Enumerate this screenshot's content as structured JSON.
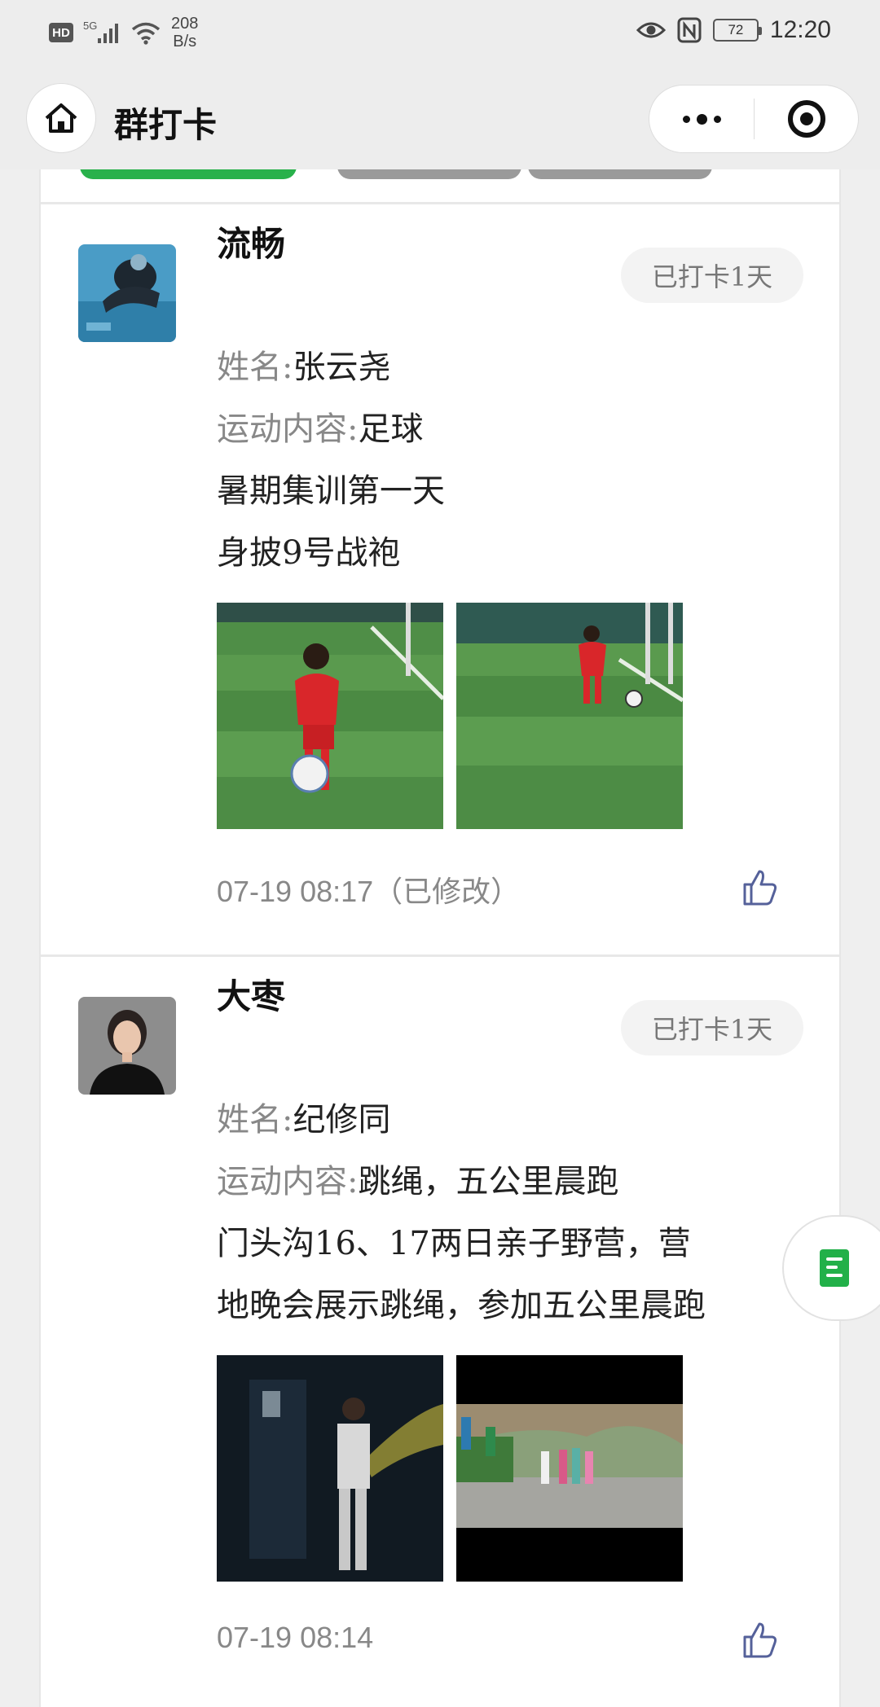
{
  "status_bar": {
    "network_type": "5G",
    "hd_label": "HD",
    "net_speed_value": "208",
    "net_speed_unit": "B/s",
    "battery": "72",
    "time": "12:20"
  },
  "nav": {
    "title": "群打卡"
  },
  "posts": [
    {
      "name": "流畅",
      "badge": "已打卡1天",
      "field1_label": "姓名:",
      "field1_value": "张云尧",
      "field2_label": "运动内容:",
      "field2_value": "足球",
      "text_line1": "暑期集训第一天",
      "text_line2": "身披9号战袍",
      "time": "07-19 08:17（已修改）"
    },
    {
      "name": "大枣",
      "badge": "已打卡1天",
      "field1_label": "姓名:",
      "field1_value": "纪修同",
      "field2_label": "运动内容:",
      "field2_value": "跳绳，五公里晨跑",
      "text_line1": "门头沟16、17两日亲子野营，营",
      "text_line2": "地晚会展示跳绳，参加五公里晨跑",
      "time": "07-19 08:14"
    }
  ],
  "colors": {
    "accent_green": "#29b14b",
    "badge_bg": "#f3f3f3",
    "muted_text": "#888888"
  }
}
